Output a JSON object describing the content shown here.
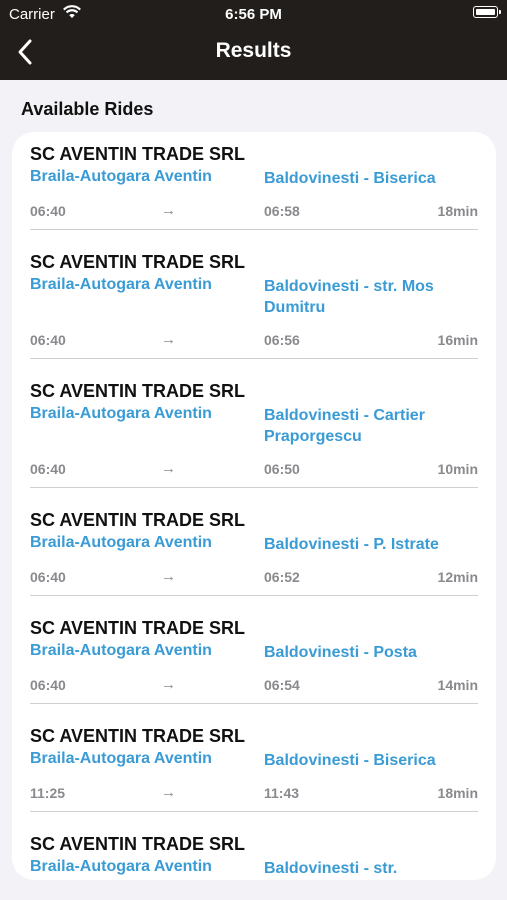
{
  "status_bar": {
    "carrier": "Carrier",
    "time": "6:56 PM"
  },
  "nav": {
    "title": "Results"
  },
  "section": {
    "title": "Available Rides"
  },
  "rides": [
    {
      "company": "SC AVENTIN TRADE SRL",
      "from": "Braila-Autogara Aventin",
      "to": "Baldovinesti - Biserica",
      "departure": "06:40",
      "arrow": "→",
      "arrival": "06:58",
      "duration": "18min"
    },
    {
      "company": "SC AVENTIN TRADE SRL",
      "from": "Braila-Autogara Aventin",
      "to": "Baldovinesti - str. Mos Dumitru",
      "departure": "06:40",
      "arrow": "→",
      "arrival": "06:56",
      "duration": "16min"
    },
    {
      "company": "SC AVENTIN TRADE SRL",
      "from": "Braila-Autogara Aventin",
      "to": "Baldovinesti - Cartier Praporgescu",
      "departure": "06:40",
      "arrow": "→",
      "arrival": "06:50",
      "duration": "10min"
    },
    {
      "company": "SC AVENTIN TRADE SRL",
      "from": "Braila-Autogara Aventin",
      "to": "Baldovinesti - P. Istrate",
      "departure": "06:40",
      "arrow": "→",
      "arrival": "06:52",
      "duration": "12min"
    },
    {
      "company": "SC AVENTIN TRADE SRL",
      "from": "Braila-Autogara Aventin",
      "to": "Baldovinesti - Posta",
      "departure": "06:40",
      "arrow": "→",
      "arrival": "06:54",
      "duration": "14min"
    },
    {
      "company": "SC AVENTIN TRADE SRL",
      "from": "Braila-Autogara Aventin",
      "to": "Baldovinesti - Biserica",
      "departure": "11:25",
      "arrow": "→",
      "arrival": "11:43",
      "duration": "18min"
    },
    {
      "company": "SC AVENTIN TRADE SRL",
      "from": "Braila-Autogara Aventin",
      "to": "Baldovinesti - str.",
      "departure": "",
      "arrow": "",
      "arrival": "",
      "duration": ""
    }
  ]
}
